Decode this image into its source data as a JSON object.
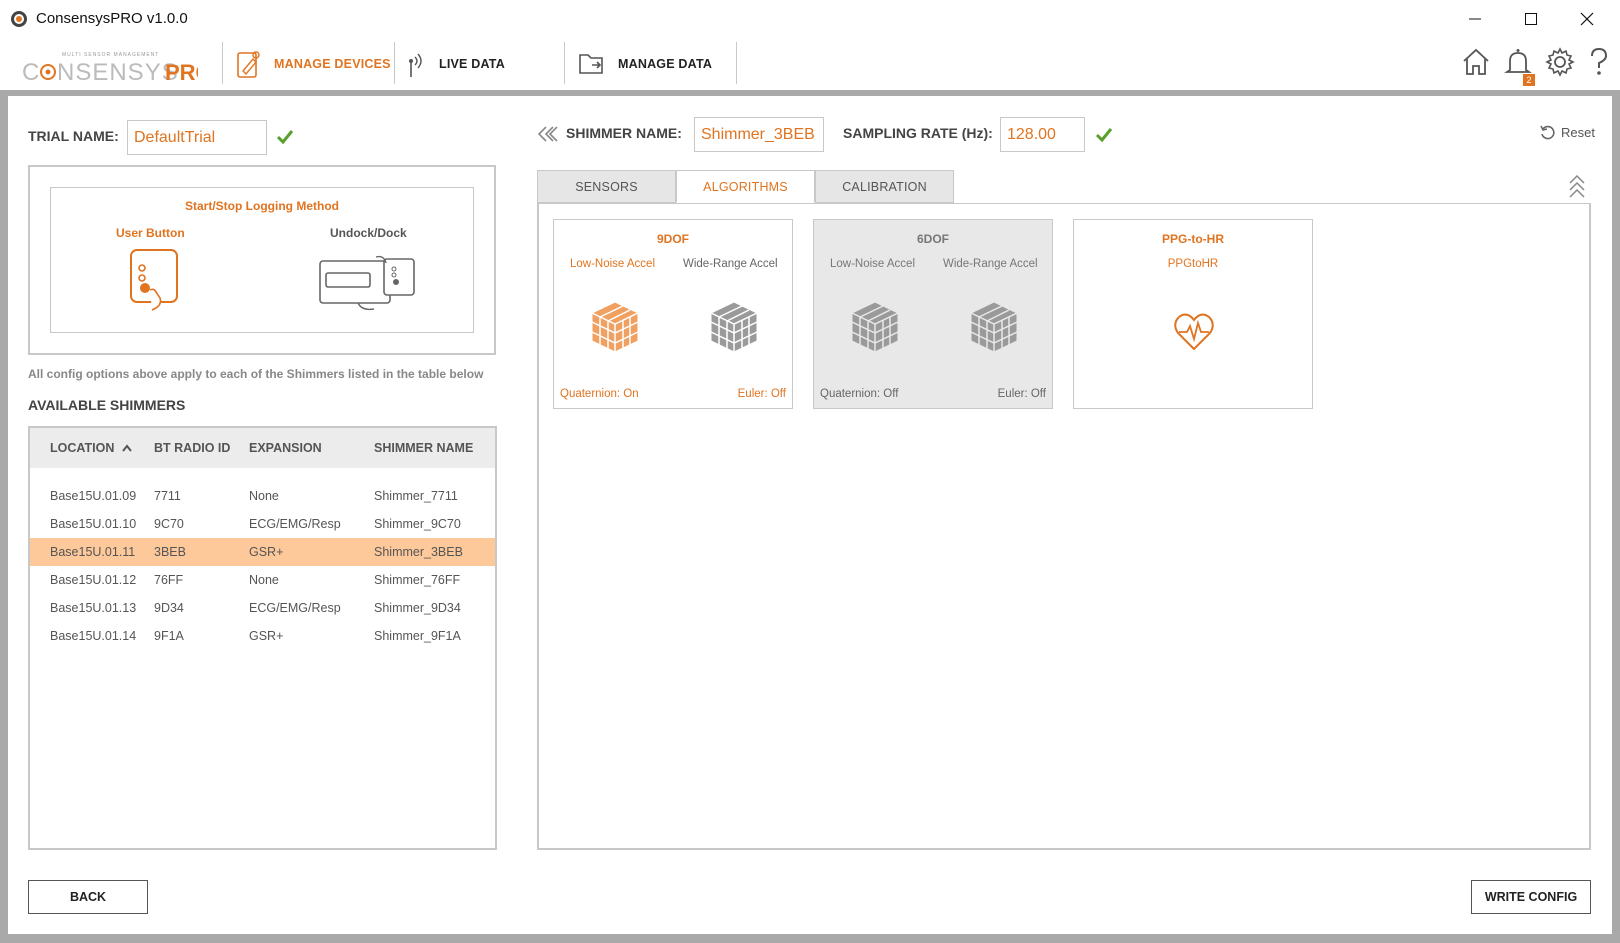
{
  "window": {
    "title": "ConsensysPRO v1.0.0"
  },
  "logo": {
    "text": "CONSENSYSPRO",
    "tagline": "MULTI SENSOR MANAGEMENT"
  },
  "nav": {
    "items": [
      {
        "label": "MANAGE DEVICES",
        "active": true
      },
      {
        "label": "LIVE DATA",
        "active": false
      },
      {
        "label": "MANAGE DATA",
        "active": false
      }
    ],
    "notifications_count": "2"
  },
  "trial": {
    "label": "TRIAL NAME:",
    "value": "DefaultTrial"
  },
  "logging": {
    "title": "Start/Stop Logging Method",
    "option_user_button": "User Button",
    "option_dock": "Undock/Dock"
  },
  "note": "All config options above apply to each of the Shimmers listed in the table below",
  "shimmers": {
    "heading": "AVAILABLE SHIMMERS",
    "columns": [
      "LOCATION",
      "BT RADIO ID",
      "EXPANSION",
      "SHIMMER NAME"
    ],
    "rows": [
      [
        "Base15U.01.09",
        "7711",
        "None",
        "Shimmer_7711"
      ],
      [
        "Base15U.01.10",
        "9C70",
        "ECG/EMG/Resp",
        "Shimmer_9C70"
      ],
      [
        "Base15U.01.11",
        "3BEB",
        "GSR+",
        "Shimmer_3BEB"
      ],
      [
        "Base15U.01.12",
        "76FF",
        "None",
        "Shimmer_76FF"
      ],
      [
        "Base15U.01.13",
        "9D34",
        "ECG/EMG/Resp",
        "Shimmer_9D34"
      ],
      [
        "Base15U.01.14",
        "9F1A",
        "GSR+",
        "Shimmer_9F1A"
      ]
    ],
    "selected_index": 2
  },
  "device": {
    "name_label": "SHIMMER NAME:",
    "name_value": "Shimmer_3BEB",
    "rate_label": "SAMPLING RATE (Hz):",
    "rate_value": "128.00",
    "reset_label": "Reset"
  },
  "tabs": [
    {
      "label": "SENSORS",
      "active": false
    },
    {
      "label": "ALGORITHMS",
      "active": true
    },
    {
      "label": "CALIBRATION",
      "active": false
    }
  ],
  "algorithms": [
    {
      "title": "9DOF",
      "left": "Low-Noise Accel",
      "right": "Wide-Range Accel",
      "foot_left": "Quaternion: On",
      "foot_right": "Euler: Off"
    },
    {
      "title": "6DOF",
      "left": "Low-Noise Accel",
      "right": "Wide-Range Accel",
      "foot_left": "Quaternion: Off",
      "foot_right": "Euler: Off"
    },
    {
      "title": "PPG-to-HR",
      "left": "PPGtoHR"
    }
  ],
  "buttons": {
    "back": "BACK",
    "write": "WRITE CONFIG"
  },
  "colors": {
    "accent": "#e07420",
    "selected_row": "#fdc89a",
    "check": "#5aa02c",
    "frame": "#a9a9a9"
  }
}
